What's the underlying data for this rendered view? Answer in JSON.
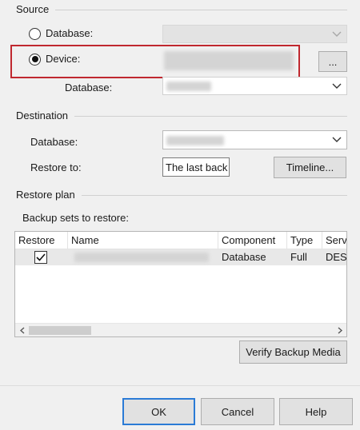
{
  "source": {
    "title": "Source",
    "database_radio_label": "Database:",
    "device_radio_label": "Device:",
    "device_browse_label": "...",
    "database_label": "Database:"
  },
  "destination": {
    "title": "Destination",
    "database_label": "Database:",
    "restore_to_label": "Restore to:",
    "restore_to_value": "The last back",
    "timeline_label": "Timeline..."
  },
  "restore_plan": {
    "title": "Restore plan",
    "backup_sets_label": "Backup sets to restore:",
    "columns": [
      "Restore",
      "Name",
      "Component",
      "Type",
      "Serv"
    ],
    "rows": [
      {
        "restore_checked": true,
        "component": "Database",
        "type": "Full",
        "server": "DES"
      }
    ],
    "verify_label": "Verify Backup Media"
  },
  "footer": {
    "ok_label": "OK",
    "cancel_label": "Cancel",
    "help_label": "Help"
  },
  "colors": {
    "highlight": "#c0282f",
    "default_button_border": "#2b7bd6"
  },
  "icons": {
    "dropdown": "chevron-down-icon",
    "checkbox": "checkmark-icon",
    "scroll_left": "arrow-left-icon",
    "scroll_right": "arrow-right-icon"
  }
}
